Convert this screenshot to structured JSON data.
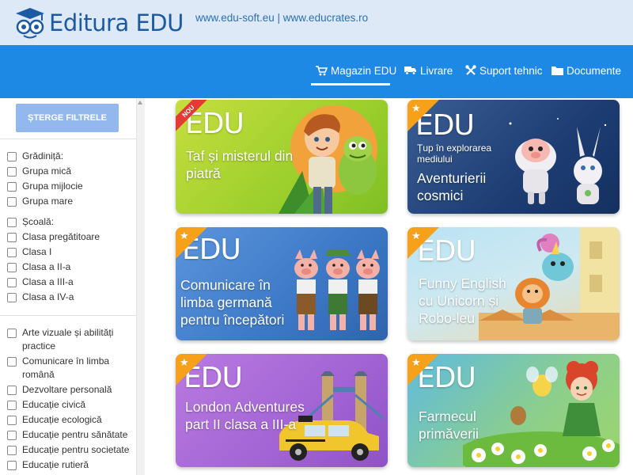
{
  "header": {
    "logo_text": "Editura EDU",
    "links": "www.edu-soft.eu | www.educrates.ro"
  },
  "nav": {
    "items": [
      {
        "label": "Magazin EDU",
        "icon": "cart-icon",
        "active": true
      },
      {
        "label": "Livrare",
        "icon": "truck-icon",
        "active": false
      },
      {
        "label": "Suport tehnic",
        "icon": "tools-icon",
        "active": false
      },
      {
        "label": "Documente",
        "icon": "folder-icon",
        "active": false
      }
    ]
  },
  "sidebar": {
    "clear_label": "ȘTERGE FILTRELE",
    "groups": [
      [
        "Grădiniță:",
        "Grupa mică",
        "Grupa mijlocie",
        "Grupa mare"
      ],
      [
        "Școală:",
        "Clasa pregătitoare",
        "Clasa I",
        "Clasa a II-a",
        "Clasa a III-a",
        "Clasa a IV-a"
      ],
      [
        "Arte vizuale și abilități practice",
        "Comunicare în limba română",
        "Dezvoltare personală",
        "Educație civică",
        "Educație ecologică",
        "Educație pentru sănătate",
        "Educație pentru societate",
        "Educație rutieră"
      ]
    ]
  },
  "products": [
    {
      "edu": "EDU",
      "title": "Taf și misterul din piatră",
      "subtitle": "",
      "badge": "NOU"
    },
    {
      "edu": "EDU",
      "title": "Aventurierii cosmici",
      "subtitle": "Țup în explorarea mediului",
      "badge": "star"
    },
    {
      "edu": "EDU",
      "title": "Comunicare în limba germană pentru începători",
      "subtitle": "",
      "badge": "star"
    },
    {
      "edu": "EDU",
      "title": "Funny English cu Unicorn și Robo-leu",
      "subtitle": "",
      "badge": "star"
    },
    {
      "edu": "EDU",
      "title": "London Adventures part II clasa a III-a",
      "subtitle": "",
      "badge": "star"
    },
    {
      "edu": "EDU",
      "title": "Farmecul primăverii",
      "subtitle": "",
      "badge": "star"
    }
  ],
  "colors": {
    "nav_bg": "#1e88e5",
    "topbar_bg": "#dde9f6",
    "clear_btn": "#93b8ee",
    "badge_star": "#f7a11a",
    "badge_new": "#e53935"
  }
}
